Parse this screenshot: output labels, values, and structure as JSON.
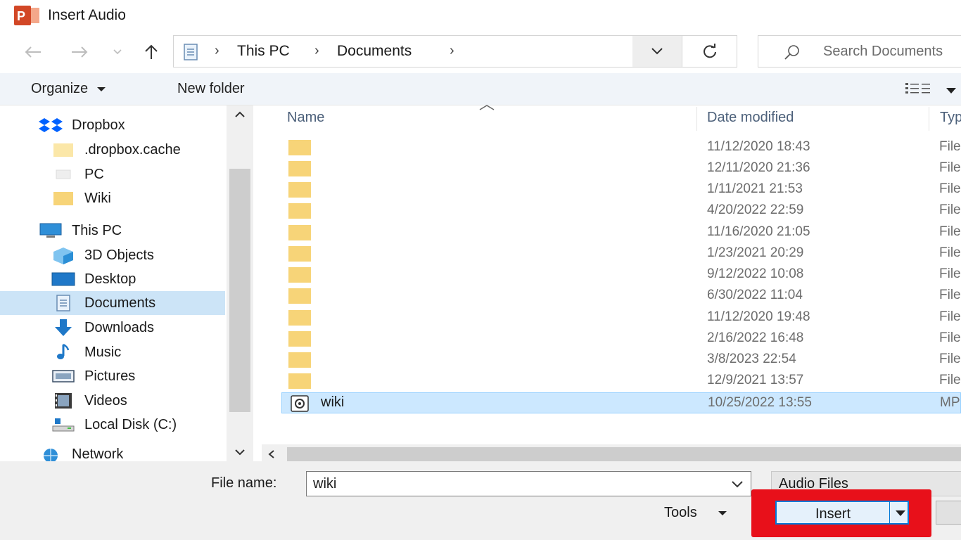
{
  "window": {
    "title": "Insert Audio",
    "app_icon_text": "P"
  },
  "address": {
    "crumbs": [
      "This PC",
      "Documents"
    ],
    "search_placeholder": "Search Documents"
  },
  "toolbar": {
    "organize": "Organize",
    "new_folder": "New folder"
  },
  "nav": {
    "items": [
      {
        "label": "Dropbox",
        "icon": "dropbox-icon"
      },
      {
        "label": ".dropbox.cache",
        "icon": "folder-icon"
      },
      {
        "label": "PC",
        "icon": "folder-icon"
      },
      {
        "label": "Wiki",
        "icon": "folder-icon"
      },
      {
        "label": "This PC",
        "icon": "this-pc-icon"
      },
      {
        "label": "3D Objects",
        "icon": "3d-objects-icon"
      },
      {
        "label": "Desktop",
        "icon": "desktop-icon"
      },
      {
        "label": "Documents",
        "icon": "documents-icon"
      },
      {
        "label": "Downloads",
        "icon": "downloads-icon"
      },
      {
        "label": "Music",
        "icon": "music-icon"
      },
      {
        "label": "Pictures",
        "icon": "pictures-icon"
      },
      {
        "label": "Videos",
        "icon": "videos-icon"
      },
      {
        "label": "Local Disk (C:)",
        "icon": "local-disk-icon"
      },
      {
        "label": "Network",
        "icon": "network-icon"
      }
    ],
    "selected": "Documents"
  },
  "list": {
    "columns": {
      "name": "Name",
      "date": "Date modified",
      "type": "Typ"
    },
    "rows": [
      {
        "name": "",
        "date": "11/12/2020 18:43",
        "type": "File"
      },
      {
        "name": "",
        "date": "12/11/2020 21:36",
        "type": "File"
      },
      {
        "name": "",
        "date": "1/11/2021 21:53",
        "type": "File"
      },
      {
        "name": "",
        "date": "4/20/2022 22:59",
        "type": "File"
      },
      {
        "name": "",
        "date": "11/16/2020 21:05",
        "type": "File"
      },
      {
        "name": "",
        "date": "1/23/2021 20:29",
        "type": "File"
      },
      {
        "name": "",
        "date": "9/12/2022 10:08",
        "type": "File"
      },
      {
        "name": "",
        "date": "6/30/2022 11:04",
        "type": "File"
      },
      {
        "name": "",
        "date": "11/12/2020 19:48",
        "type": "File"
      },
      {
        "name": "",
        "date": "2/16/2022 16:48",
        "type": "File"
      },
      {
        "name": "",
        "date": "3/8/2023 22:54",
        "type": "File"
      },
      {
        "name": "",
        "date": "12/9/2021 13:57",
        "type": "File"
      },
      {
        "name": "wiki",
        "date": "10/25/2022 13:55",
        "type": "MP"
      }
    ]
  },
  "bottom": {
    "file_name_label": "File name:",
    "file_name_value": "wiki",
    "file_type": "Audio Files",
    "tools": "Tools",
    "insert": "Insert"
  },
  "colors": {
    "highlight": "#e8101a",
    "selection": "#cce8ff",
    "accent": "#0078d7"
  }
}
